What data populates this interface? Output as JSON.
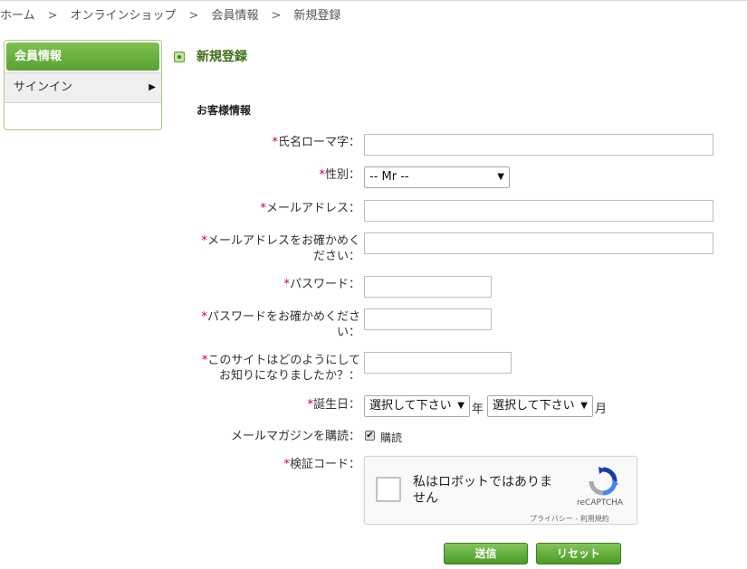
{
  "breadcrumb": {
    "items": [
      "ホーム",
      "オンラインショップ",
      "会員情報",
      "新規登録"
    ],
    "separator": ">"
  },
  "sidebar": {
    "header": "会員情報",
    "items": [
      {
        "label": "サインイン",
        "arrow": "▶"
      }
    ]
  },
  "page": {
    "title": "新規登録",
    "section": "お客様情報"
  },
  "form": {
    "required_mark": "*",
    "name_label": "氏名ローマ字：",
    "name_value": "",
    "gender_label": "性別：",
    "gender_selected": "-- Mr --",
    "email_label": "メールアドレス：",
    "email_value": "",
    "email_confirm_label_1": "メールアドレスをお確かめく",
    "email_confirm_label_2": "ださい：",
    "email_confirm_value": "",
    "password_label": "パスワード：",
    "password_confirm_label_1": "パスワードをお確かめくださ",
    "password_confirm_label_2": "い：",
    "referral_label_1": "このサイトはどのようにして",
    "referral_label_2": "お知りになりましたか？：",
    "referral_value": "",
    "birthday_label": "誕生日：",
    "birthday_year_selected": "選択して下さい",
    "birthday_year_unit": "年",
    "birthday_month_selected": "選択して下さい",
    "birthday_month_unit": "月",
    "newsletter_label": "メールマガジンを購読：",
    "newsletter_option": "購読",
    "newsletter_checked": true,
    "captcha_label": "検証コード："
  },
  "captcha": {
    "text": "私はロボットではありません",
    "brand": "reCAPTCHA",
    "links": "プライバシー - 利用規約",
    "checked": false
  },
  "buttons": {
    "submit": "送信",
    "reset": "リセット"
  },
  "colors": {
    "accent_green": "#5ba135",
    "title_green": "#3f6f16",
    "required_red": "#d0021b"
  }
}
